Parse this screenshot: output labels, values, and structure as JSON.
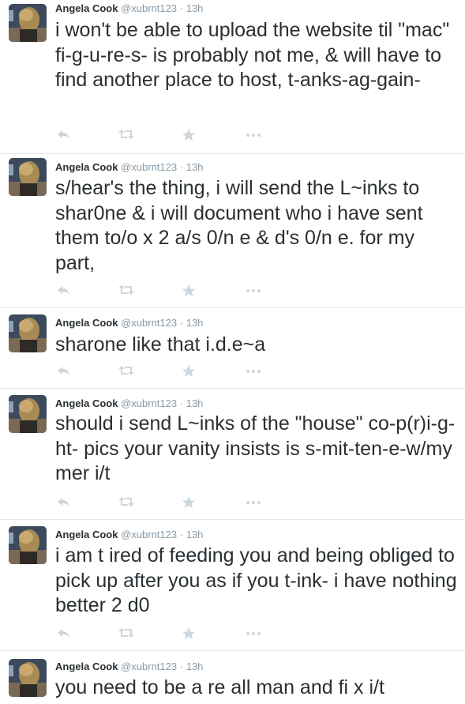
{
  "tweets": [
    {
      "name": "Angela Cook",
      "handle": "@xubrnt123",
      "separator": "·",
      "time": "13h",
      "text": "i won't be able to upload the website til \"mac\" fi-g-u-re-s- is probably not me, & will have to find another place to host, t-anks-ag-gain-"
    },
    {
      "name": "Angela Cook",
      "handle": "@xubrnt123",
      "separator": "·",
      "time": "13h",
      "text": "s/hear's the thing, i will send the L~inks to shar0ne & i will document who i have sent them to/o x 2 a/s 0/n e & d's 0/n e. for my part,"
    },
    {
      "name": "Angela Cook",
      "handle": "@xubrnt123",
      "separator": "·",
      "time": "13h",
      "text": "sharone like that i.d.e~a"
    },
    {
      "name": "Angela Cook",
      "handle": "@xubrnt123",
      "separator": "·",
      "time": "13h",
      "text": "should i send L~inks of the \"house\" co-p(r)i-g-ht- pics your vanity insists is s-mit-ten-e-w/my mer i/t"
    },
    {
      "name": "Angela Cook",
      "handle": "@xubrnt123",
      "separator": "·",
      "time": "13h",
      "text": "i am t ired of feeding you and being obliged to pick up after you as if you t-ink- i have nothing better 2 d0"
    },
    {
      "name": "Angela Cook",
      "handle": "@xubrnt123",
      "separator": "·",
      "time": "13h",
      "text": "you need to be a re all man and fi x i/t"
    }
  ],
  "actions": {
    "reply_icon": "reply-icon",
    "retweet_icon": "retweet-icon",
    "favorite_icon": "favorite-star-icon",
    "more_icon": "more-dots-icon"
  },
  "colors": {
    "text": "#292f33",
    "meta": "#8899a6",
    "icon": "#ccd6dd",
    "divider": "#e1e8ed"
  }
}
